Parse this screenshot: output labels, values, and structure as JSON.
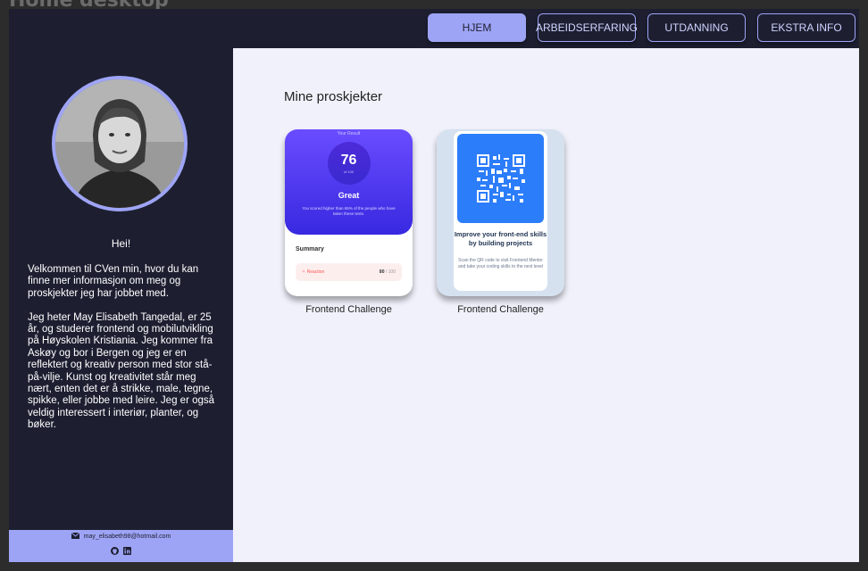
{
  "frame_title": "Home desktop",
  "nav": {
    "items": [
      {
        "label": "HJEM",
        "active": true
      },
      {
        "label": "ARBEIDSERFARING",
        "active": false
      },
      {
        "label": "UTDANNING",
        "active": false
      },
      {
        "label": "EKSTRA INFO",
        "active": false
      }
    ]
  },
  "sidebar": {
    "greeting": "Hei!",
    "bio": [
      "Velkommen til CVen min, hvor du kan finne mer informasjon om meg og proskjekter jeg har jobbet med.",
      "Jeg heter May Elisabeth Tangedal, er 25 år, og studerer frontend og mobilutvikling på Høyskolen Kristiania. Jeg kommer fra Askøy og bor i Bergen og jeg er en reflektert og kreativ person med stor stå-på-vilje. Kunst og kreativitet står meg nært, enten det er å strikke, male, tegne, spikke, eller jobbe med leire. Jeg er også veldig interessert i interiør, planter, og bøker."
    ],
    "footer": {
      "email": "may_elisabeth98@hotmail.com",
      "email_icon": "envelope-icon",
      "social_icons": [
        "github-icon",
        "linkedin-icon"
      ]
    }
  },
  "main": {
    "title": "Mine proskjekter",
    "projects": [
      {
        "label": "Frontend Challenge",
        "preview": {
          "heading": "Your Result",
          "score": "76",
          "of": "of 100",
          "result_word": "Great",
          "desc": "You scored higher than 65% of the people who have taken these tests.",
          "summary": "Summary",
          "row_label": "Reaction",
          "row_score": "80",
          "row_total": " / 100"
        }
      },
      {
        "label": "Frontend Challenge",
        "preview": {
          "title": "Improve your front-end skills by building projects",
          "desc": "Scan the QR code to visit Frontend Mentor and take your coding skills to the next level"
        }
      }
    ]
  },
  "colors": {
    "dark_bg": "#1d1f31",
    "accent": "#9ea4f5",
    "main_bg": "#f1f1fb"
  }
}
